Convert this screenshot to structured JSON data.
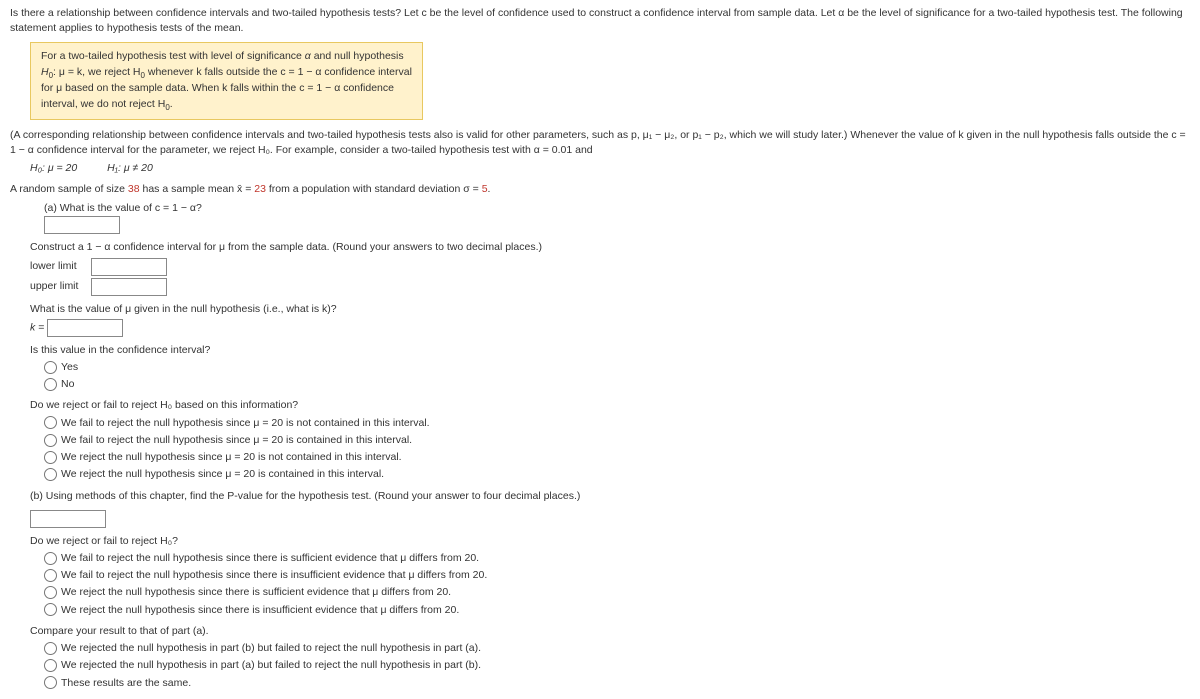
{
  "intro": "Is there a relationship between confidence intervals and two-tailed hypothesis tests? Let c be the level of confidence used to construct a confidence interval from sample data. Let α be the level of significance for a two-tailed hypothesis test. The following statement applies to hypothesis tests of the mean.",
  "box": {
    "l1_a": "For a two-tailed hypothesis test with level of significance ",
    "l1_b": " and null hypothesis",
    "l2_a": "H",
    "l2_b": ": μ = k, we reject H",
    "l2_c": " whenever k falls outside the c = 1 − α confidence interval",
    "l3": "for μ based on the sample data. When k falls within the c = 1 − α confidence",
    "l4_a": "interval, we do not reject H",
    "l4_b": "."
  },
  "para2": "(A corresponding relationship between confidence intervals and two-tailed hypothesis tests also is valid for other parameters, such as p, μ₁ − μ₂, or p₁ − p₂, which we will study later.) Whenever the value of k given in the null hypothesis falls outside the c = 1 − α confidence interval for the parameter, we reject H₀. For example, consider a two-tailed hypothesis test with α = 0.01 and",
  "hyp": {
    "h0": "H₀: μ = 20",
    "h1": "H₁: μ ≠ 20"
  },
  "sample": {
    "pre": "A random sample of size ",
    "n": "38",
    "mid1": " has a sample mean x̄ = ",
    "xbar": "23",
    "mid2": " from a population with standard deviation σ = ",
    "sigma": "5",
    "end": "."
  },
  "qa": "(a) What is the value of c = 1 − α?",
  "ci_prompt": "Construct a 1 − α confidence interval for μ from the sample data. (Round your answers to two decimal places.)",
  "ll": "lower limit",
  "ul": "upper limit",
  "kq": "What is the value of μ given in the null hypothesis (i.e., what is k)?",
  "klabel": "k =",
  "inint": "Is this value in the confidence interval?",
  "yes": "Yes",
  "no": "No",
  "rej_q": "Do we reject or fail to reject H₀ based on this information?",
  "rej_opts": [
    "We fail to reject the null hypothesis since μ = 20 is not contained in this interval.",
    "We fail to reject the null hypothesis since μ = 20 is contained in this interval.",
    "We reject the null hypothesis since μ = 20 is not contained in this interval.",
    "We reject the null hypothesis since μ = 20 is contained in this interval."
  ],
  "partb": "(b) Using methods of this chapter, find the P-value for the hypothesis test. (Round your answer to four decimal places.)",
  "rej2_q": "Do we reject or fail to reject H₀?",
  "rej2_opts": [
    "We fail to reject the null hypothesis since there is sufficient evidence that μ differs from 20.",
    "We fail to reject the null hypothesis since there is insufficient evidence that μ differs from 20.",
    "We reject the null hypothesis since there is sufficient evidence that μ differs from 20.",
    "We reject the null hypothesis since there is insufficient evidence that μ differs from 20."
  ],
  "cmp_q": "Compare your result to that of part (a).",
  "cmp_opts": [
    "We rejected the null hypothesis in part (b) but failed to reject the null hypothesis in part (a).",
    "We rejected the null hypothesis in part (a) but failed to reject the null hypothesis in part (b).",
    "These results are the same."
  ]
}
